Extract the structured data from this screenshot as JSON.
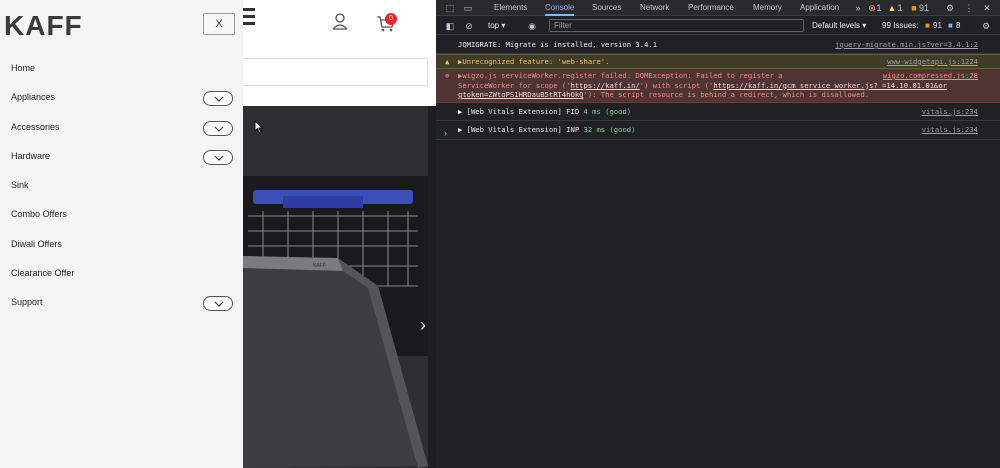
{
  "site": {
    "cart_count": "0",
    "carousel_next": "›"
  },
  "drawer": {
    "logo": "KAFF",
    "close_label": "X",
    "menu": [
      {
        "label": "Home",
        "expandable": false
      },
      {
        "label": "Appliances",
        "expandable": true
      },
      {
        "label": "Accessories",
        "expandable": true
      },
      {
        "label": "Hardware",
        "expandable": true
      },
      {
        "label": "Sink",
        "expandable": false
      },
      {
        "label": "Combo Offers",
        "expandable": false
      },
      {
        "label": "Diwali Offers",
        "expandable": false
      },
      {
        "label": "Clearance Offer",
        "expandable": false
      },
      {
        "label": "Support",
        "expandable": true
      }
    ]
  },
  "devtools": {
    "tabs": [
      "Elements",
      "Console",
      "Sources",
      "Network",
      "Performance",
      "Memory",
      "Application"
    ],
    "active_tab": "Console",
    "more": "»",
    "errors_count": "1",
    "warnings_count": "1",
    "issues_badge_count": "91",
    "context": "top",
    "filter_placeholder": "Filter",
    "levels": "Default levels",
    "issues_label": "99 Issues:",
    "issues_warn": "91",
    "issues_info": "8",
    "logs": [
      {
        "level": "info",
        "text": "JQMIGRATE: Migrate is installed, version 3.4.1",
        "source": "jquery-migrate.min.js?ver=3.4.1:2"
      },
      {
        "level": "warn",
        "text": "▶Unrecognized feature: 'web-share'.",
        "source": "www-widgetapi.js:1224"
      },
      {
        "level": "error",
        "text1": "▶wigzo.js serviceWorker.register failed:  DOMException: Failed to register a",
        "text2": "ServiceWorker for scope ('",
        "link1": "https://kaff.in/",
        "text3": "') with script ('",
        "link2": "https://kaff.in/gcm_service_worker.js?_=14.10.01.01&or",
        "link3": "gtoken=ZWtoPS1HRDauB5tRT4hOkQ",
        "text4": "'): The script resource is behind a redirect, which is disallowed.",
        "source": "wigzo.compressed.js:28"
      },
      {
        "level": "info",
        "prefix": "▶ [Web Vitals Extension] FID ",
        "value": "4 ms (good)",
        "source": "vitals.js:234"
      },
      {
        "level": "info",
        "prefix": "▶ [Web Vitals Extension] INP ",
        "value": "32 ms (good)",
        "source": "vitals.js:234"
      }
    ],
    "prompt": "›"
  }
}
